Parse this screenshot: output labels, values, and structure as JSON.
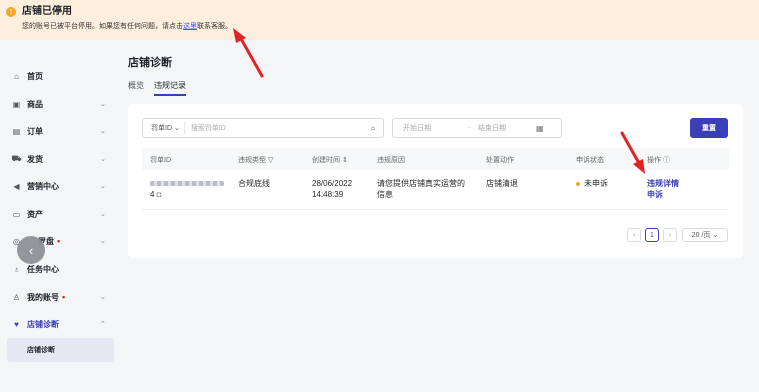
{
  "banner": {
    "icon": "warning-icon",
    "title": "店铺已停用",
    "desc_before": "您的账号已被平台停用。如果您有任何问题，请点击",
    "link": "这里",
    "desc_after": "联系客服。"
  },
  "sidebar": {
    "items": [
      {
        "label": "首页",
        "icon": "home-icon"
      },
      {
        "label": "商品",
        "icon": "product-icon"
      },
      {
        "label": "订单",
        "icon": "order-icon"
      },
      {
        "label": "发货",
        "icon": "shipping-icon"
      },
      {
        "label": "营销中心",
        "icon": "marketing-icon"
      },
      {
        "label": "资产",
        "icon": "wallet-icon"
      },
      {
        "label": "罗盘",
        "icon": "compass-icon"
      },
      {
        "label": "任务中心",
        "icon": "task-icon"
      },
      {
        "label": "我的账号",
        "icon": "account-icon"
      },
      {
        "label": "店铺诊断",
        "icon": "diagnosis-icon"
      }
    ],
    "sub_item": "店铺诊断"
  },
  "main": {
    "title": "店铺诊断",
    "tabs": [
      "概览",
      "违规记录"
    ],
    "filter": {
      "id_select": "罚单ID",
      "id_placeholder": "搜索罚单ID",
      "start_placeholder": "开始日期",
      "separator": "-",
      "end_placeholder": "结束日期"
    },
    "reset_label": "重置",
    "columns": [
      "罚单ID",
      "违规类型",
      "创建时间",
      "违规原因",
      "处置动作",
      "申诉状态",
      "操作"
    ],
    "row": {
      "id_tail": "4",
      "type": "合规底线",
      "date": "28/06/2022",
      "time": "14:48:39",
      "reason_line1": "请您提供店铺真实运营的",
      "reason_line2": "信息",
      "action": "店铺清退",
      "status": "未申诉",
      "op1": "违规详情",
      "op2": "申诉"
    },
    "pagination": {
      "prev": "‹",
      "current": "1",
      "next": "›",
      "page_size": "20 /页"
    }
  },
  "colors": {
    "accent": "#3b3fb5",
    "warning": "#f5a623",
    "banner_bg": "#fdeedd",
    "arrow": "#e02424"
  }
}
